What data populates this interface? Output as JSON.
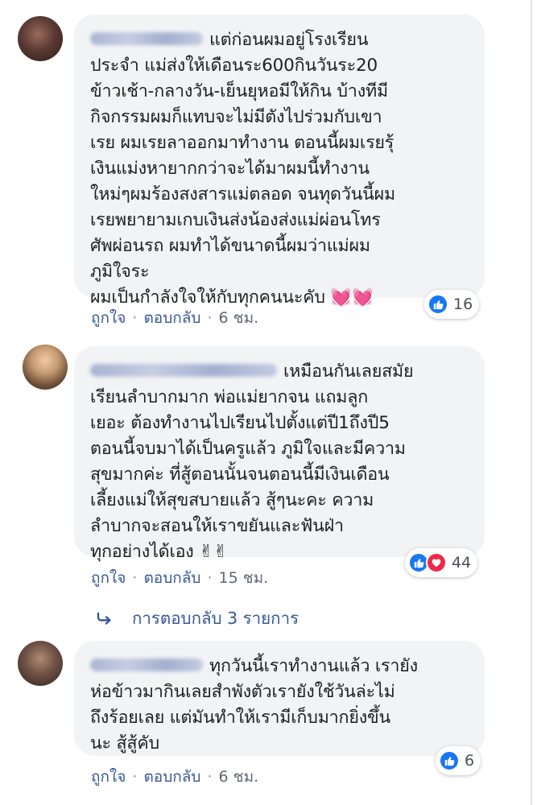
{
  "comments": [
    {
      "text": "แต่ก่อนผมอยู่โรงเรียน\nประจำ แม่ส่งให้เดือนระ600กินวันระ20\nข้าวเช้า-กลางวัน-เย็นยุหอมีให้กิน บ้างทีมี\nกิจกรรมผมก็แทบจะไม่มีตังไปร่วมกับเขา\nเรย ผมเรยลาออกมาทำงาน ตอนนี้ผมเรยรุ้\nเงินแม่งหายากกว่าจะได้มาผมนี้ทำงาน\nใหม่ๆผมร้องสงสารแม่ตลอด จนทุดวันนี้ผม\nเรยพยายามเกบเงินส่งน้องส่งแม่ผ่อนโทร\nศัพผ่อนรถ ผมทำได้ขนาดนี้ผมว่าแม่ผม\nภูมิใจระ\nผมเป็นกำลังใจให้กับทุกคนนะคับ 💓💓",
      "reaction_count": "16",
      "like_label": "ถูกใจ",
      "reply_label": "ตอบกลับ",
      "time": "6 ชม."
    },
    {
      "text": "เหมือนกันเลยสมัย\nเรียนลำบากมาก พ่อแม่ยากจน แถมลูก\nเยอะ ต้องทำงานไปเรียนไปตั้งแต่ปี1ถึงปี5\nตอนนี้จบมาได้เป็นครูแล้ว ภูมิใจและมีความ\nสุขมากค่ะ ที่สู้ตอนนั้นจนตอนนี้มีเงินเดือน\nเลี้ยงแม่ให้สุขสบายแล้ว สู้ๆนะคะ ความ\nลำบากจะสอนให้เราขยันและฟันฝ่า\nทุกอย่างได้เอง ✌✌",
      "reaction_count": "44",
      "like_label": "ถูกใจ",
      "reply_label": "ตอบกลับ",
      "time": "15 ชม.",
      "replies_label": "การตอบกลับ 3 รายการ"
    },
    {
      "text": "ทุกวันนี้เราทำงานแล้ว เรายัง\nห่อข้าวมากินเลยสำพังตัวเรายังใช้วันล่ะไม่\nถึงร้อยเลย แต่มันทำให้เรามีเก็บมากยิ่งขึ้น\nนะ สู้สู้คับ",
      "reaction_count": "6",
      "like_label": "ถูกใจ",
      "reply_label": "ตอบกลับ",
      "time": "6 ชม."
    }
  ],
  "colors": {
    "link": "#385898",
    "bubble": "#f2f3f5",
    "like": "#1877f2",
    "love": "#f0284a"
  },
  "icons": [
    "like-reaction-icon",
    "love-reaction-icon",
    "reply-arrow-icon"
  ]
}
